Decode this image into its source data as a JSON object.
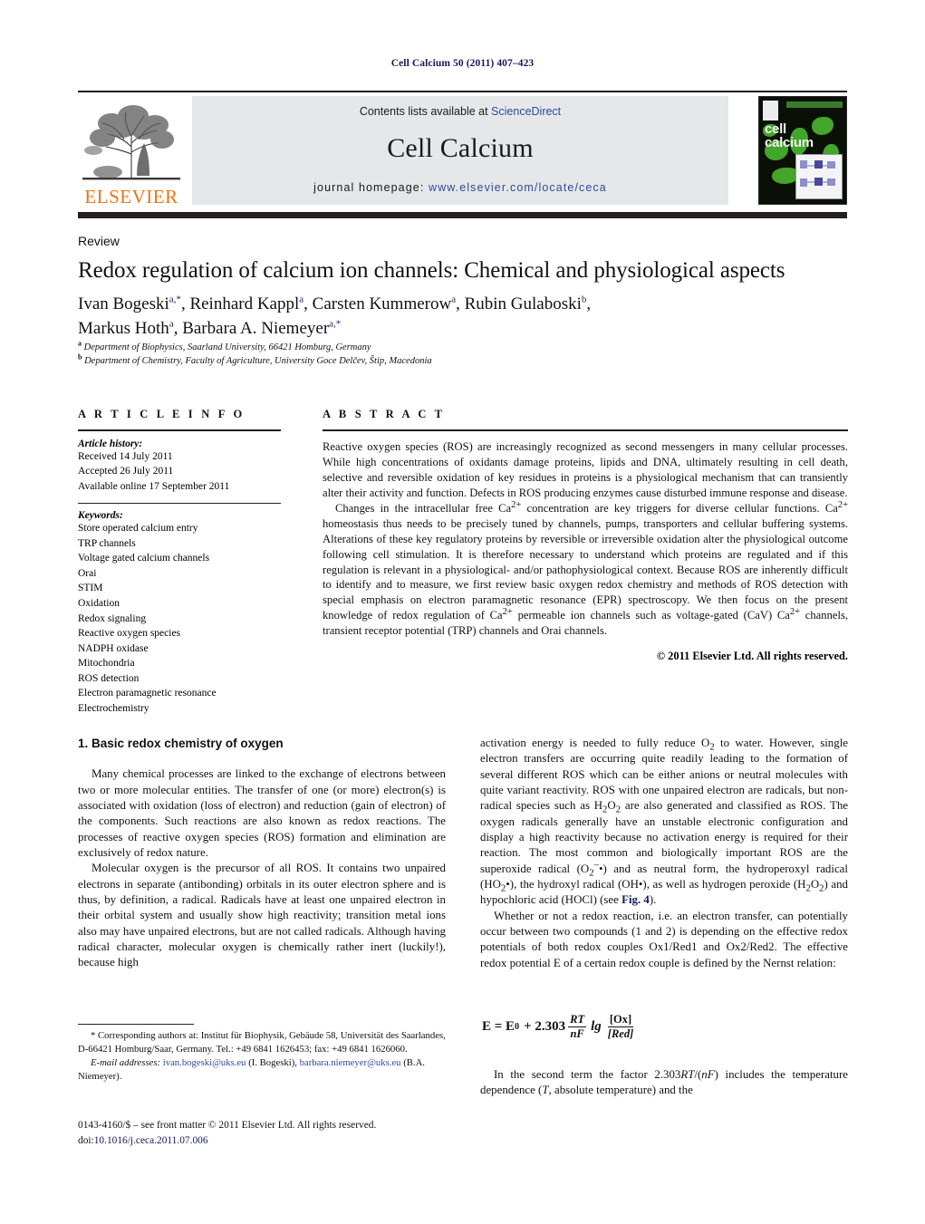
{
  "running_head": "Cell Calcium 50 (2011) 407–423",
  "masthead": {
    "contents_prefix": "Contents lists available at ",
    "contents_link": "ScienceDirect",
    "journal_name": "Cell Calcium",
    "homepage_prefix": "journal homepage: ",
    "homepage_url": "www.elsevier.com/locate/ceca",
    "publisher_wordmark": "ELSEVIER",
    "cover_title_line1": "cell",
    "cover_title_line2": "calcium",
    "accent_link_color": "#2b4c9b",
    "elsevier_orange": "#e87613",
    "band_gray": "#e6e7e9"
  },
  "article": {
    "doctype": "Review",
    "title": "Redox regulation of calcium ion channels: Chemical and physiological aspects",
    "authors_line1": "Ivan Bogeski<sup>a,*</sup>, Reinhard Kappl<sup>a</sup>, Carsten Kummerow<sup>a</sup>, Rubin Gulaboski<sup>b</sup>,",
    "authors_line2": "Markus Hoth<sup>a</sup>, Barbara A. Niemeyer<sup>a,*</sup>",
    "affiliation_a": "<sup>a</sup> Department of Biophysics, Saarland University, 66421 Homburg, Germany",
    "affiliation_b": "<sup>b</sup> Department of Chemistry, Faculty of Agriculture, University Goce Delčev, Štip, Macedonia"
  },
  "info": {
    "heading": "A R T I C L E   I N F O",
    "history_label": "Article history:",
    "history": [
      "Received 14 July 2011",
      "Accepted 26 July 2011",
      "Available online 17 September 2011"
    ],
    "keywords_label": "Keywords:",
    "keywords": [
      "Store operated calcium entry",
      "TRP channels",
      "Voltage gated calcium channels",
      "Orai",
      "STIM",
      "Oxidation",
      "Redox signaling",
      "Reactive oxygen species",
      "NADPH oxidase",
      "Mitochondria",
      "ROS detection",
      "Electron paramagnetic resonance",
      "Electrochemistry"
    ]
  },
  "abstract": {
    "heading": "A B S T R A C T",
    "paragraph1": "Reactive oxygen species (ROS) are increasingly recognized as second messengers in many cellular processes. While high concentrations of oxidants damage proteins, lipids and DNA, ultimately resulting in cell death, selective and reversible oxidation of key residues in proteins is a physiological mechanism that can transiently alter their activity and function. Defects in ROS producing enzymes cause disturbed immune response and disease.",
    "paragraph2": "Changes in the intracellular free Ca<sup>2+</sup> concentration are key triggers for diverse cellular functions. Ca<sup>2+</sup> homeostasis thus needs to be precisely tuned by channels, pumps, transporters and cellular buffering systems. Alterations of these key regulatory proteins by reversible or irreversible oxidation alter the physiological outcome following cell stimulation. It is therefore necessary to understand which proteins are regulated and if this regulation is relevant in a physiological- and/or pathophysiological context. Because ROS are inherently difficult to identify and to measure, we first review basic oxygen redox chemistry and methods of ROS detection with special emphasis on electron paramagnetic resonance (EPR) spectroscopy. We then focus on the present knowledge of redox regulation of Ca<sup>2+</sup> permeable ion channels such as voltage-gated (CaV) Ca<sup>2+</sup> channels, transient receptor potential (TRP) channels and Orai channels.",
    "copyright": "© 2011 Elsevier Ltd. All rights reserved."
  },
  "body": {
    "section_number_title": "1.  Basic redox chemistry of oxygen",
    "left_paragraphs": [
      "Many chemical processes are linked to the exchange of electrons between two or more molecular entities. The transfer of one (or more) electron(s) is associated with oxidation (loss of electron) and reduction (gain of electron) of the components. Such reactions are also known as redox reactions. The processes of reactive oxygen species (ROS) formation and elimination are exclusively of redox nature.",
      "Molecular oxygen is the precursor of all ROS. It contains two unpaired electrons in separate (antibonding) orbitals in its outer electron sphere and is thus, by definition, a radical. Radicals have at least one unpaired electron in their orbital system and usually show high reactivity; transition metal ions also may have unpaired electrons, but are not called radicals. Although having radical character, molecular oxygen is chemically rather inert (luckily!), because high"
    ],
    "right_paragraph_1": "activation energy is needed to fully reduce O<sub>2</sub> to water. However, single electron transfers are occurring quite readily leading to the formation of several different ROS which can be either anions or neutral molecules with quite variant reactivity. ROS with one unpaired electron are radicals, but non-radical species such as H<sub>2</sub>O<sub>2</sub> are also generated and classified as ROS. The oxygen radicals generally have an unstable electronic configuration and display a high reactivity because no activation energy is required for their reaction. The most common and biologically important ROS are the superoxide radical (O<sub>2</sub><sup>–</sup>•) and as neutral form, the hydroperoxyl radical (HO<sub>2</sub>•), the hydroxyl radical (OH•), as well as hydrogen peroxide (H<sub>2</sub>O<sub>2</sub>) and hypochloric acid (HOCl) (see <span class=\"linkblue\">Fig. 4</span>).",
    "right_paragraph_2": "Whether or not a redox reaction, i.e. an electron transfer, can potentially occur between two compounds (1 and 2) is depending on the effective redox potentials of both redox couples Ox1/Red1 and Ox2/Red2. The effective redox potential E of a certain redox couple is defined by the Nernst relation:",
    "equation": {
      "lhs": "E = E",
      "lhs_sub": "0",
      "plus": "+ 2.303",
      "frac1_num": "RT",
      "frac1_den": "nF",
      "log": "lg",
      "frac2_num": "[Ox]",
      "frac2_den": "[Red]"
    },
    "tail_paragraph": "In the second term the factor 2.303<i>RT</i>/(<i>nF</i>) includes the temperature dependence (<i>T</i>, absolute temperature) and the"
  },
  "footnotes": {
    "corresponding": "* Corresponding authors at: Institut für Biophysik, Gebäude 58, Universität des Saarlandes, D-66421 Homburg/Saar, Germany. Tel.: +49 6841 1626453; fax: +49 6841 1626060.",
    "email_label": "E-mail addresses:",
    "email_1": "ivan.bogeski@uks.eu",
    "email_1_owner": "(I. Bogeski),",
    "email_2": "barbara.niemeyer@uks.eu",
    "email_2_owner": "(B.A. Niemeyer).",
    "imprint": "0143-4160/$ – see front matter © 2011 Elsevier Ltd. All rights reserved.",
    "doi_label": "doi:",
    "doi_value": "10.1016/j.ceca.2011.07.006"
  }
}
